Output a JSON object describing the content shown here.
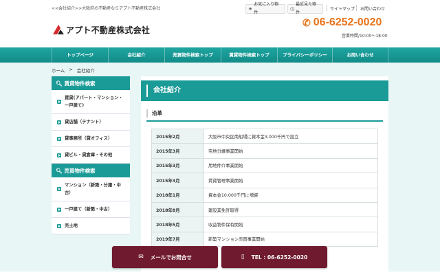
{
  "header": {
    "tagline": "<<会社紹介>>大阪府の不動産ならアプト不動産株式会社",
    "favorites_label": "お気に入り物件",
    "recent_label": "最近見た物件",
    "sitemap_label": "サイトマップ",
    "contact_label": "お問い合わせ",
    "company_name": "アプト不動産株式会社",
    "phone": "06-6252-0020",
    "hours": "営業時間/10:00～18:00"
  },
  "nav": {
    "items": [
      {
        "label": "トップページ"
      },
      {
        "label": "会社紹介"
      },
      {
        "label": "売買物件検索トップ"
      },
      {
        "label": "賃貸物件検索トップ"
      },
      {
        "label": "プライバシーポリシー"
      },
      {
        "label": "お問い合わせ"
      }
    ]
  },
  "breadcrumb": {
    "home": "ホーム",
    "separator": ">",
    "current": "会社紹介"
  },
  "sidebar": {
    "rental_heading": "賃貸物件検索",
    "rental_items": [
      {
        "label": "賃貸(アパート・マンション・一戸建て)"
      },
      {
        "label": "貸店舗（テナント）"
      },
      {
        "label": "貸事務所（貸オフィス）"
      },
      {
        "label": "貸ビル・貸倉庫・その他"
      }
    ],
    "sale_heading": "売買物件検索",
    "sale_items": [
      {
        "label": "マンション（新築・分譲・中古）"
      },
      {
        "label": "一戸建て（新築・中古）"
      },
      {
        "label": "売土地"
      }
    ]
  },
  "main": {
    "title": "会社紹介",
    "section": "沿革",
    "history": [
      {
        "date": "2015年2月",
        "event": "大阪市中央区南船場に資本金3,000千円で設立"
      },
      {
        "date": "2015年3月",
        "event": "宅地分譲事業開始"
      },
      {
        "date": "2015年3月",
        "event": "用地仲介事業開始"
      },
      {
        "date": "2015年3月",
        "event": "賃貸管理事業開始"
      },
      {
        "date": "2018年1月",
        "event": "資本金10,000千円に増資"
      },
      {
        "date": "2018年8月",
        "event": "建設業免許取得"
      },
      {
        "date": "2018年5月",
        "event": "収益物件保有開始"
      },
      {
        "date": "2019年7月",
        "event": "新築マンション売買事業開始"
      }
    ]
  },
  "cta": {
    "mail_label": "メールでお問合せ",
    "tel_label": "TEL : 06-6252-0020"
  },
  "colors": {
    "brand": "#1b9b97",
    "accent": "#e8731a",
    "cta": "#6f1a2e"
  }
}
